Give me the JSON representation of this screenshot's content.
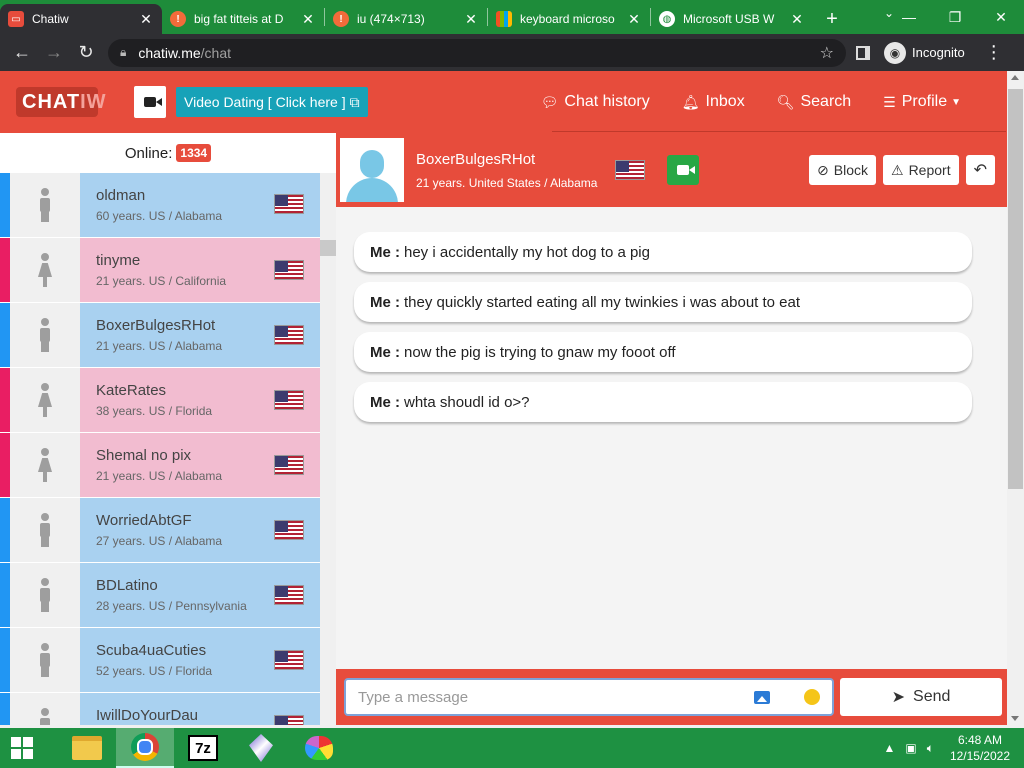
{
  "browser": {
    "tabs": [
      {
        "title": "Chatiw",
        "icon": "chatiw-icon",
        "active": true
      },
      {
        "title": "big fat titteis at D",
        "icon": "site-icon"
      },
      {
        "title": "iu (474×713)",
        "icon": "site-icon"
      },
      {
        "title": "keyboard microso",
        "icon": "bing-icon"
      },
      {
        "title": "Microsoft USB W",
        "icon": "globe-icon"
      }
    ],
    "url_host": "chatiw.me",
    "url_path": "/chat",
    "incognito_label": "Incognito"
  },
  "site": {
    "logo_text": "CHAT",
    "logo_text_2": "IW",
    "video_dating_label": "Video Dating [ Click here ]",
    "nav": [
      {
        "label": "Chat history",
        "icon": "chat-bubbles-icon"
      },
      {
        "label": "Inbox",
        "icon": "bell-icon"
      },
      {
        "label": "Search",
        "icon": "search-icon"
      },
      {
        "label": "Profile",
        "icon": "sliders-icon"
      }
    ]
  },
  "sidebar": {
    "online_label": "Online:",
    "online_count": "1334",
    "users": [
      {
        "name": "oldman",
        "meta": "60 years. US / Alabama",
        "gender": "male"
      },
      {
        "name": "tinyme",
        "meta": "21 years. US / California",
        "gender": "female"
      },
      {
        "name": "BoxerBulgesRHot",
        "meta": "21 years. US / Alabama",
        "gender": "male"
      },
      {
        "name": "KateRates",
        "meta": "38 years. US / Florida",
        "gender": "female"
      },
      {
        "name": "Shemal no pix",
        "meta": "21 years. US / Alabama",
        "gender": "female"
      },
      {
        "name": "WorriedAbtGF",
        "meta": "27 years. US / Alabama",
        "gender": "male"
      },
      {
        "name": "BDLatino",
        "meta": "28 years. US / Pennsylvania",
        "gender": "male"
      },
      {
        "name": "Scuba4uaCuties",
        "meta": "52 years. US / Florida",
        "gender": "male"
      },
      {
        "name": "IwillDoYourDau",
        "meta": "",
        "gender": "male"
      }
    ]
  },
  "chat": {
    "partner_name": "BoxerBulgesRHot",
    "partner_meta": "21 years. United States / Alabama",
    "block_label": "Block",
    "report_label": "Report",
    "messages": [
      {
        "sender": "Me :",
        "text": "hey i accidentally my hot dog to a pig"
      },
      {
        "sender": "Me :",
        "text": "they quickly started eating all my twinkies i was about to eat"
      },
      {
        "sender": "Me :",
        "text": "now the pig is trying to gnaw my fooot off"
      },
      {
        "sender": "Me :",
        "text": "whta shoudl id o>?"
      }
    ],
    "input_placeholder": "Type a message",
    "send_label": "Send"
  },
  "taskbar": {
    "time": "6:48 AM",
    "date": "12/15/2022",
    "sevenzip_label": "7z"
  }
}
